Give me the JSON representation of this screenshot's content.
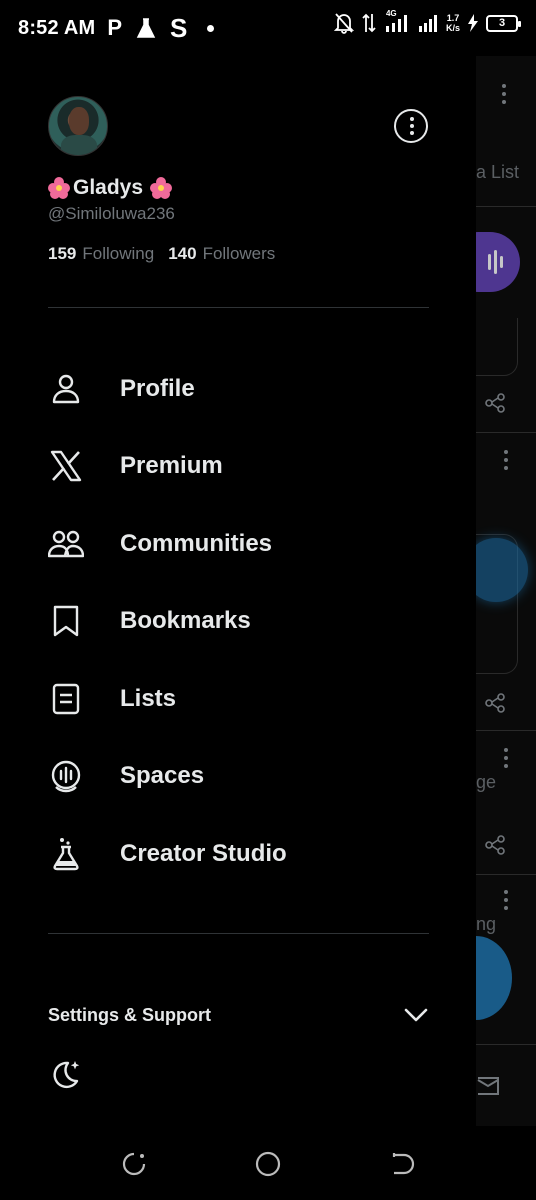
{
  "status_bar": {
    "time": "8:52 AM",
    "app_icons": [
      "P",
      "flask-icon",
      "S",
      "dot"
    ],
    "network": "4G",
    "speed_value": "1.7",
    "speed_unit": "K/s",
    "battery": "3"
  },
  "profile": {
    "display_name": "Gladys",
    "handle": "@Similoluwa236",
    "following_count": "159",
    "following_label": "Following",
    "followers_count": "140",
    "followers_label": "Followers"
  },
  "menu": {
    "items": [
      {
        "label": "Profile",
        "icon": "person-icon"
      },
      {
        "label": "Premium",
        "icon": "x-logo-icon"
      },
      {
        "label": "Communities",
        "icon": "communities-icon"
      },
      {
        "label": "Bookmarks",
        "icon": "bookmark-icon"
      },
      {
        "label": "Lists",
        "icon": "list-icon"
      },
      {
        "label": "Spaces",
        "icon": "spaces-icon"
      },
      {
        "label": "Creator Studio",
        "icon": "flask-icon"
      }
    ]
  },
  "settings": {
    "label": "Settings & Support"
  },
  "background": {
    "snippets": [
      "a List",
      "ge",
      "ng"
    ]
  },
  "colors": {
    "background": "#000000",
    "text": "#e7e9ea",
    "muted": "#71767b",
    "divider": "#2f3336",
    "spaces_purple": "#5b3ea8",
    "fab_blue": "#1d6fa8"
  }
}
